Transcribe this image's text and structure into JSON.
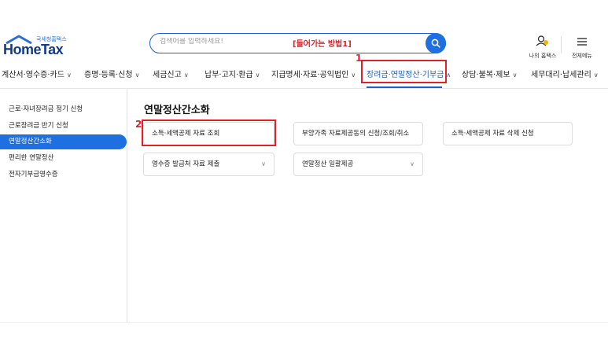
{
  "logo": {
    "small": "국세청홈택스",
    "main": "HomeTax"
  },
  "search": {
    "placeholder": "검색어를 입력하세요!",
    "annotation": "[들어가는 방법1]"
  },
  "utility": {
    "my_hometax": "나의 홈택스",
    "all_menu": "전체메뉴"
  },
  "annotations": {
    "step1": "1",
    "step2": "2"
  },
  "gnb": {
    "items": [
      {
        "label": "계산서·영수증·카드"
      },
      {
        "label": "증명·등록·신청"
      },
      {
        "label": "세금신고"
      },
      {
        "label": "납부·고지·환급"
      },
      {
        "label": "지급명세·자료·공익법인"
      },
      {
        "label": "장려금·연말정산·기부금"
      },
      {
        "label": "상담·불복·제보"
      },
      {
        "label": "세무대리·납세관리"
      }
    ]
  },
  "sidebar": {
    "items": [
      {
        "label": "근로·자녀장려금 정기 신청"
      },
      {
        "label": "근로장려금 반기 신청"
      },
      {
        "label": "연말정산간소화"
      },
      {
        "label": "편리한 연말정산"
      },
      {
        "label": "전자기부금영수증"
      }
    ],
    "active_index": 2
  },
  "main": {
    "title": "연말정산간소화",
    "cards": [
      {
        "label": "소득·세액공제 자료 조회"
      },
      {
        "label": "부양가족 자료제공동의 신청/조회/취소"
      },
      {
        "label": "소득·세액공제 자료 삭제 신청"
      },
      {
        "label": "영수증 발급처 자료 제출"
      },
      {
        "label": "연말정산 일괄제공"
      }
    ]
  },
  "colors": {
    "accent": "#1e6fe0",
    "annotation": "#e0202a",
    "logo": "#123a8c"
  }
}
